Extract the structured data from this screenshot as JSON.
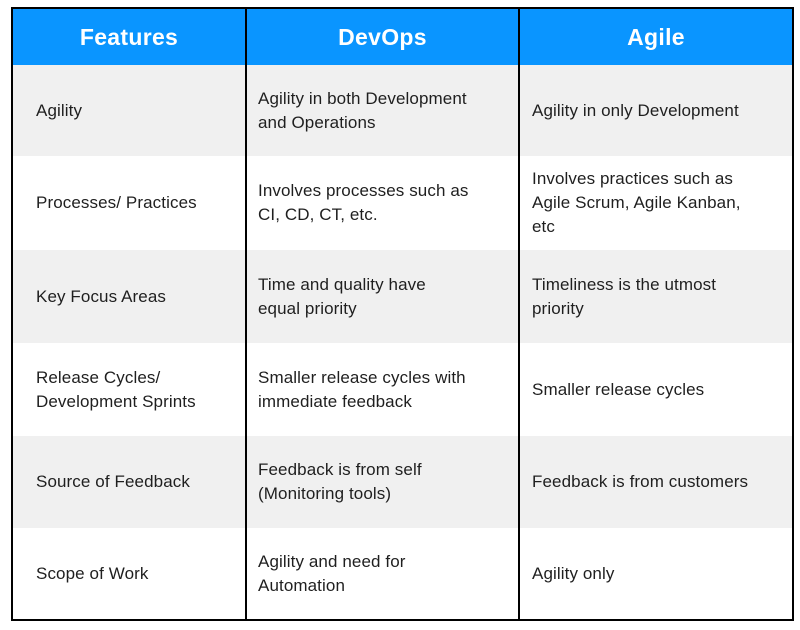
{
  "table": {
    "colors": {
      "header_bg": "#0a95ff",
      "header_text": "#ffffff",
      "row_alt_bg": "#f0f0f0",
      "row_bg": "#ffffff",
      "border": "#000000"
    },
    "headers": [
      "Features",
      "DevOps",
      "Agile"
    ],
    "rows": [
      {
        "feature": "Agility",
        "devops": "Agility in both Development\nand  Operations",
        "agile": "Agility in only Development"
      },
      {
        "feature": "Processes/ Practices",
        "devops": "Involves processes such as\nCI, CD, CT, etc.",
        "agile": "Involves practices such as\nAgile Scrum, Agile Kanban,\netc"
      },
      {
        "feature": "Key Focus Areas",
        "devops": "Time and quality have\nequal priority",
        "agile": "Timeliness is the utmost\npriority"
      },
      {
        "feature": "Release Cycles/\nDevelopment Sprints",
        "devops": "Smaller release cycles with\nimmediate feedback",
        "agile": "Smaller release cycles"
      },
      {
        "feature": "Source of Feedback",
        "devops": "Feedback is from self\n(Monitoring tools)",
        "agile": "Feedback is from customers"
      },
      {
        "feature": "Scope of Work",
        "devops": "Agility and need for\nAutomation",
        "agile": "Agility only"
      }
    ]
  }
}
